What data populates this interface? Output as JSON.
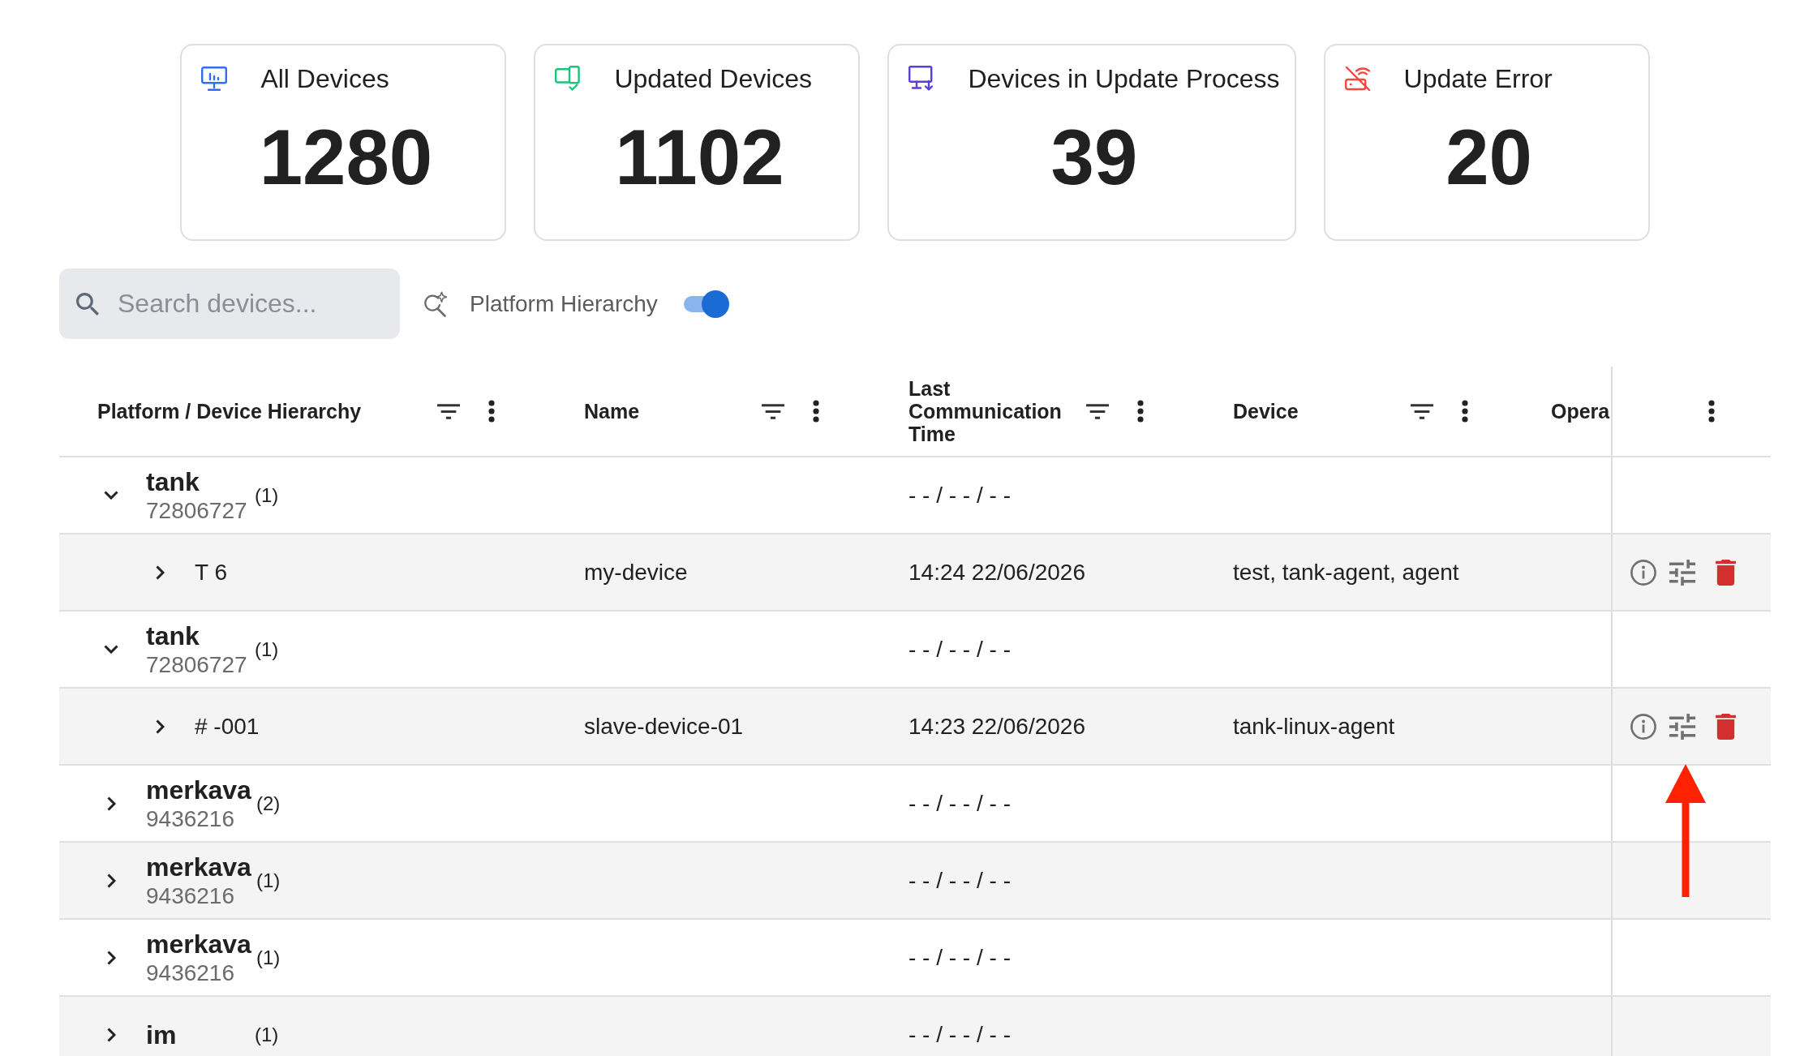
{
  "cards": [
    {
      "kind": "all",
      "title": "All Devices",
      "value": "1280"
    },
    {
      "kind": "updated",
      "title": "Updated Devices",
      "value": "1102"
    },
    {
      "kind": "in_progress",
      "title": "Devices in Update Process",
      "value": "39"
    },
    {
      "kind": "error",
      "title": "Update Error",
      "value": "20"
    }
  ],
  "search": {
    "placeholder": "Search devices..."
  },
  "hierarchy_toggle": {
    "label": "Platform Hierarchy",
    "on": true
  },
  "table": {
    "columns": [
      {
        "label": "Platform / Device Hierarchy"
      },
      {
        "label": "Name"
      },
      {
        "label": "Last Communication Time"
      },
      {
        "label": "Device"
      },
      {
        "label": "Opera"
      }
    ],
    "rows": [
      {
        "kind": "platform",
        "hierarchy": "tank",
        "id": "72806727",
        "count": "(1)",
        "last_communication": "- - / - - / - -",
        "expanded": true,
        "children": [
          {
            "kind": "device",
            "hierarchy": "T 6",
            "name": "my-device",
            "last_communication": "14:24 22/06/2026",
            "device": "test, tank-agent, agent",
            "expanded": false
          }
        ]
      },
      {
        "kind": "platform",
        "hierarchy": "tank",
        "id": "72806727",
        "count": "(1)",
        "last_communication": "- - / - - / - -",
        "expanded": true,
        "children": [
          {
            "kind": "device",
            "hierarchy": "# -001",
            "name": "slave-device-01",
            "last_communication": "14:23 22/06/2026",
            "device": "tank-linux-agent",
            "expanded": false
          }
        ]
      },
      {
        "kind": "platform",
        "hierarchy": "merkava",
        "id": "9436216",
        "count": "(2)",
        "last_communication": "- - / - - / - -",
        "expanded": false
      },
      {
        "kind": "platform",
        "hierarchy": "merkava",
        "id": "9436216",
        "count": "(1)",
        "last_communication": "- - / - - / - -",
        "expanded": false
      },
      {
        "kind": "platform",
        "hierarchy": "merkava",
        "id": "9436216",
        "count": "(1)",
        "last_communication": "- - / - - / - -",
        "expanded": false
      },
      {
        "kind": "platform",
        "hierarchy": "im",
        "count": "(1)",
        "last_communication": "- - / - - / - -",
        "expanded": false
      }
    ]
  }
}
